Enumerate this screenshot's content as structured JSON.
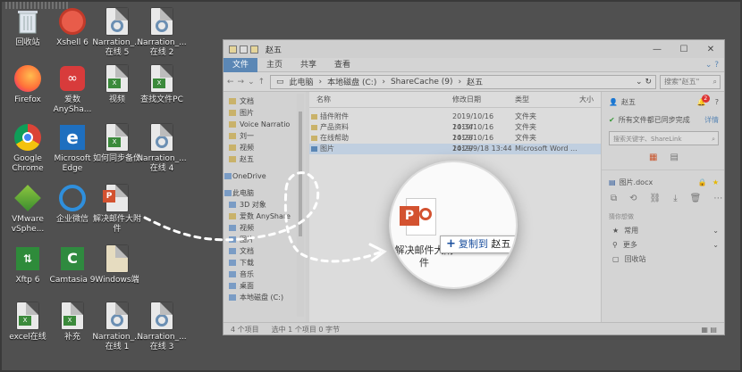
{
  "desktop": {
    "icons": [
      {
        "id": "recycle",
        "label": "回收站"
      },
      {
        "id": "xshell",
        "label": "Xshell 6"
      },
      {
        "id": "narr5",
        "label": "Narration_...\n在线 5"
      },
      {
        "id": "narr2",
        "label": "Narration_...\n在线 2"
      },
      {
        "id": "firefox",
        "label": "Firefox"
      },
      {
        "id": "anyshare",
        "label": "爱数\nAnySha..."
      },
      {
        "id": "video",
        "label": "视频"
      },
      {
        "id": "findpc",
        "label": "查找文件PC"
      },
      {
        "id": "chrome",
        "label": "Google\nChrome"
      },
      {
        "id": "edge",
        "label": "Microsoft\nEdge"
      },
      {
        "id": "sync",
        "label": "如何同步备份"
      },
      {
        "id": "narr4",
        "label": "Narration_...\n在线 4"
      },
      {
        "id": "vmware",
        "label": "VMware\nvSphe..."
      },
      {
        "id": "wework",
        "label": "企业微信"
      },
      {
        "id": "mailattach",
        "label": "解决邮件大附\n件"
      },
      {
        "id": "xftp",
        "label": "Xftp 6"
      },
      {
        "id": "camtasia",
        "label": "Camtasia 9"
      },
      {
        "id": "windows",
        "label": "Windows端"
      },
      {
        "id": "excel",
        "label": "excel在线"
      },
      {
        "id": "buchong",
        "label": "补充"
      },
      {
        "id": "narr1",
        "label": "Narration_...\n在线 1"
      },
      {
        "id": "narr3",
        "label": "Narration_...\n在线 3"
      }
    ]
  },
  "explorer": {
    "title": "赵五",
    "ribbon_tabs": [
      "文件",
      "主页",
      "共享",
      "查看"
    ],
    "path": [
      "此电脑",
      "本地磁盘 (C:)",
      "ShareCache (9)",
      "赵五"
    ],
    "search_placeholder": "搜索\"赵五\"",
    "nav": [
      {
        "label": "文档",
        "kind": "top"
      },
      {
        "label": "图片",
        "kind": "top"
      },
      {
        "label": "Voice Narratio",
        "kind": "top"
      },
      {
        "label": "刘一",
        "kind": "top"
      },
      {
        "label": "视频",
        "kind": "top"
      },
      {
        "label": "赵五",
        "kind": "top"
      },
      {
        "label": "",
        "kind": "gap"
      },
      {
        "label": "OneDrive",
        "kind": "blue"
      },
      {
        "label": "",
        "kind": "gap"
      },
      {
        "label": "此电脑",
        "kind": "blue"
      },
      {
        "label": "3D 对象",
        "kind": "sub"
      },
      {
        "label": "爱数 AnyShare",
        "kind": "sub"
      },
      {
        "label": "视频",
        "kind": "sub"
      },
      {
        "label": "图片",
        "kind": "sub"
      },
      {
        "label": "文档",
        "kind": "sub"
      },
      {
        "label": "下载",
        "kind": "sub"
      },
      {
        "label": "音乐",
        "kind": "sub"
      },
      {
        "label": "桌面",
        "kind": "sub"
      },
      {
        "label": "本地磁盘 (C:)",
        "kind": "sub"
      }
    ],
    "columns": {
      "name": "名称",
      "date": "修改日期",
      "type": "类型",
      "size": "大小"
    },
    "files": [
      {
        "name": "插件附件",
        "date": "2019/10/16 14:34",
        "type": "文件夹",
        "selected": false
      },
      {
        "name": "产品资料",
        "date": "2019/10/16 14:28",
        "type": "文件夹",
        "selected": false
      },
      {
        "name": "在线帮助",
        "date": "2019/10/16 14:29",
        "type": "文件夹",
        "selected": false
      },
      {
        "name": "图片",
        "date": "2019/9/18 13:44",
        "type": "Microsoft Word ...",
        "selected": true
      }
    ],
    "status": {
      "count": "4 个项目",
      "selected": "选中 1 个项目  0 字节"
    }
  },
  "panel": {
    "user": "赵五",
    "badge": "2",
    "sync_text": "所有文件都已同步完成",
    "detail": "详情",
    "search_placeholder": "搜索关键字、ShareLink",
    "file": "图片.docx",
    "section": "猜你想做",
    "items": [
      "常用",
      "更多",
      "回收站"
    ]
  },
  "magnifier": {
    "file_label": "解决邮件大附\n件",
    "copy_prefix": "复制到",
    "copy_dest": "赵五"
  }
}
